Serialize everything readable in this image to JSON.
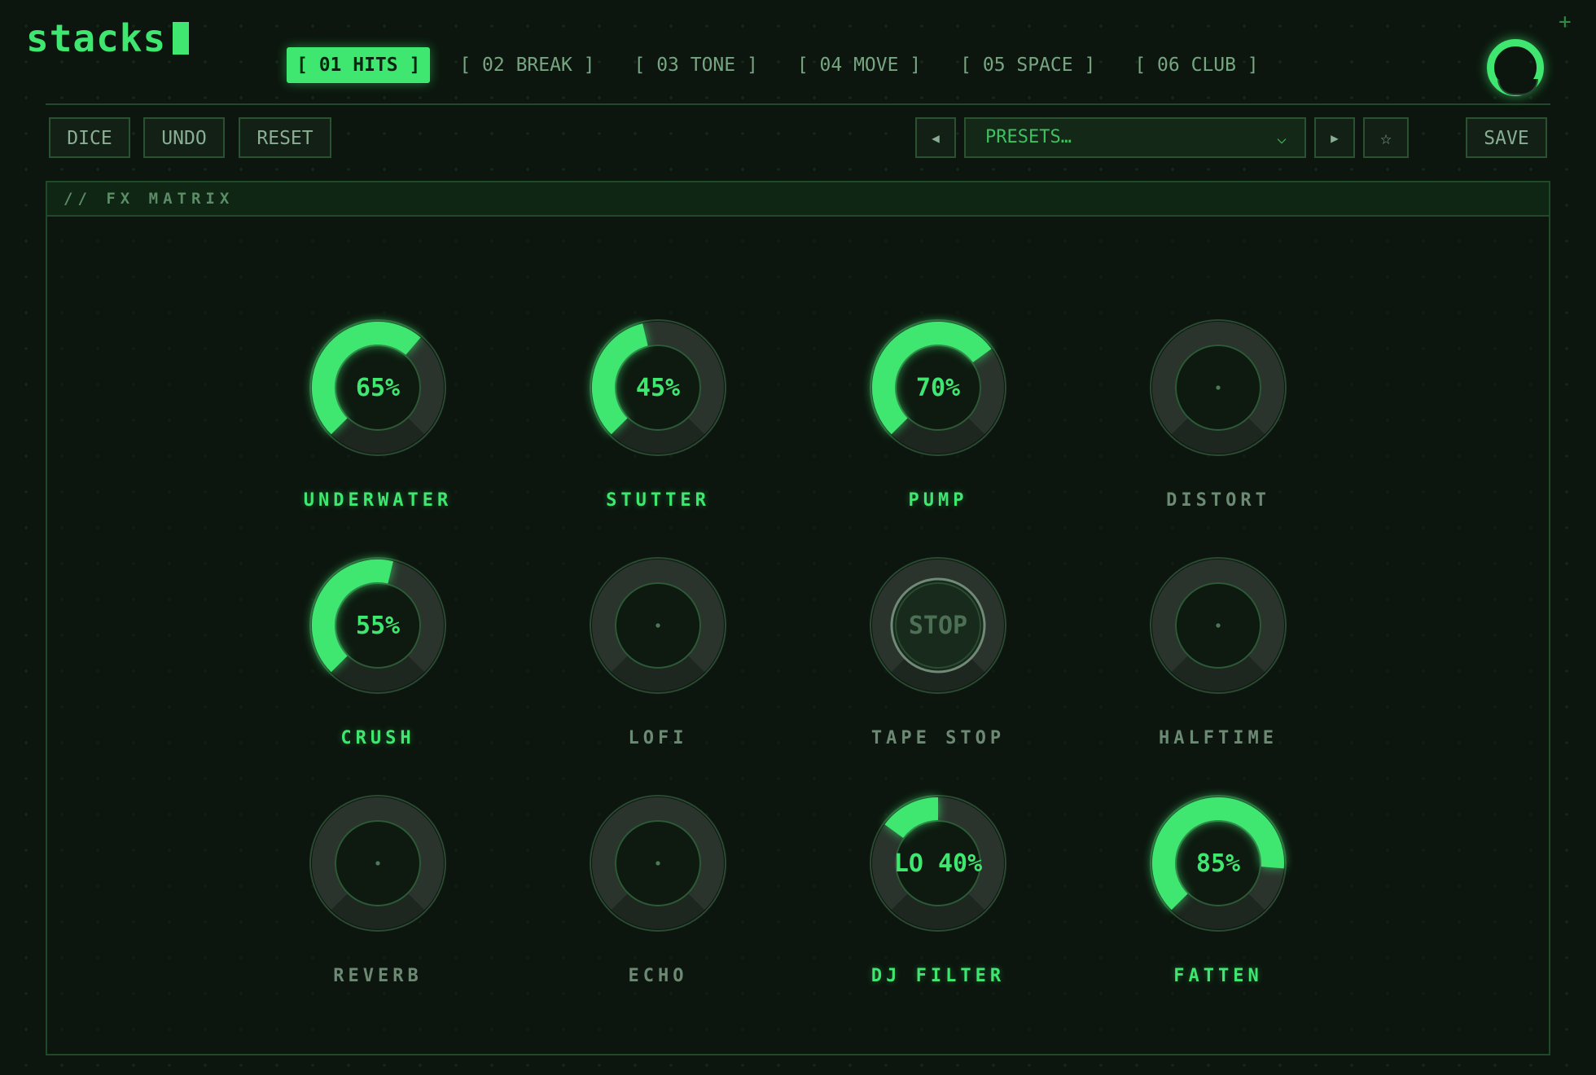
{
  "app": {
    "name": "stacks",
    "accent": "#3fe770"
  },
  "tabs": [
    {
      "label": "[ 01 HITS ]",
      "active": true
    },
    {
      "label": "[ 02 BREAK ]",
      "active": false
    },
    {
      "label": "[ 03 TONE ]",
      "active": false
    },
    {
      "label": "[ 04 MOVE ]",
      "active": false
    },
    {
      "label": "[ 05 SPACE ]",
      "active": false
    },
    {
      "label": "[ 06 CLUB ]",
      "active": false
    }
  ],
  "toolbar": {
    "dice": "DICE",
    "undo": "UNDO",
    "reset": "RESET",
    "prev_icon": "◀",
    "next_icon": "▶",
    "preset_placeholder": "PRESETS…",
    "preset_chevron": "⌵",
    "favorite_icon": "☆",
    "save": "SAVE"
  },
  "matrix": {
    "title": "// FX MATRIX",
    "knobs": [
      {
        "id": "underwater",
        "label": "UNDERWATER",
        "value": 0.65,
        "display": "65%",
        "active": true
      },
      {
        "id": "stutter",
        "label": "STUTTER",
        "value": 0.45,
        "display": "45%",
        "active": true
      },
      {
        "id": "pump",
        "label": "PUMP",
        "value": 0.7,
        "display": "70%",
        "active": true
      },
      {
        "id": "distort",
        "label": "DISTORT",
        "value": 0,
        "display": "",
        "active": false
      },
      {
        "id": "crush",
        "label": "CRUSH",
        "value": 0.55,
        "display": "55%",
        "active": true
      },
      {
        "id": "lofi",
        "label": "LOFI",
        "value": 0,
        "display": "",
        "active": false
      },
      {
        "id": "tape-stop",
        "label": "TAPE STOP",
        "value": 0,
        "display": "STOP",
        "active": false,
        "mode": "button"
      },
      {
        "id": "halftime",
        "label": "HALFTIME",
        "value": 0,
        "display": "",
        "active": false
      },
      {
        "id": "reverb",
        "label": "REVERB",
        "value": 0,
        "display": "",
        "active": false
      },
      {
        "id": "echo",
        "label": "ECHO",
        "value": 0,
        "display": "",
        "active": false
      },
      {
        "id": "dj-filter",
        "label": "DJ FILTER",
        "value": -0.4,
        "display": "LO 40%",
        "active": true,
        "mode": "bipolar"
      },
      {
        "id": "fatten",
        "label": "FATTEN",
        "value": 0.85,
        "display": "85%",
        "active": true
      }
    ]
  }
}
